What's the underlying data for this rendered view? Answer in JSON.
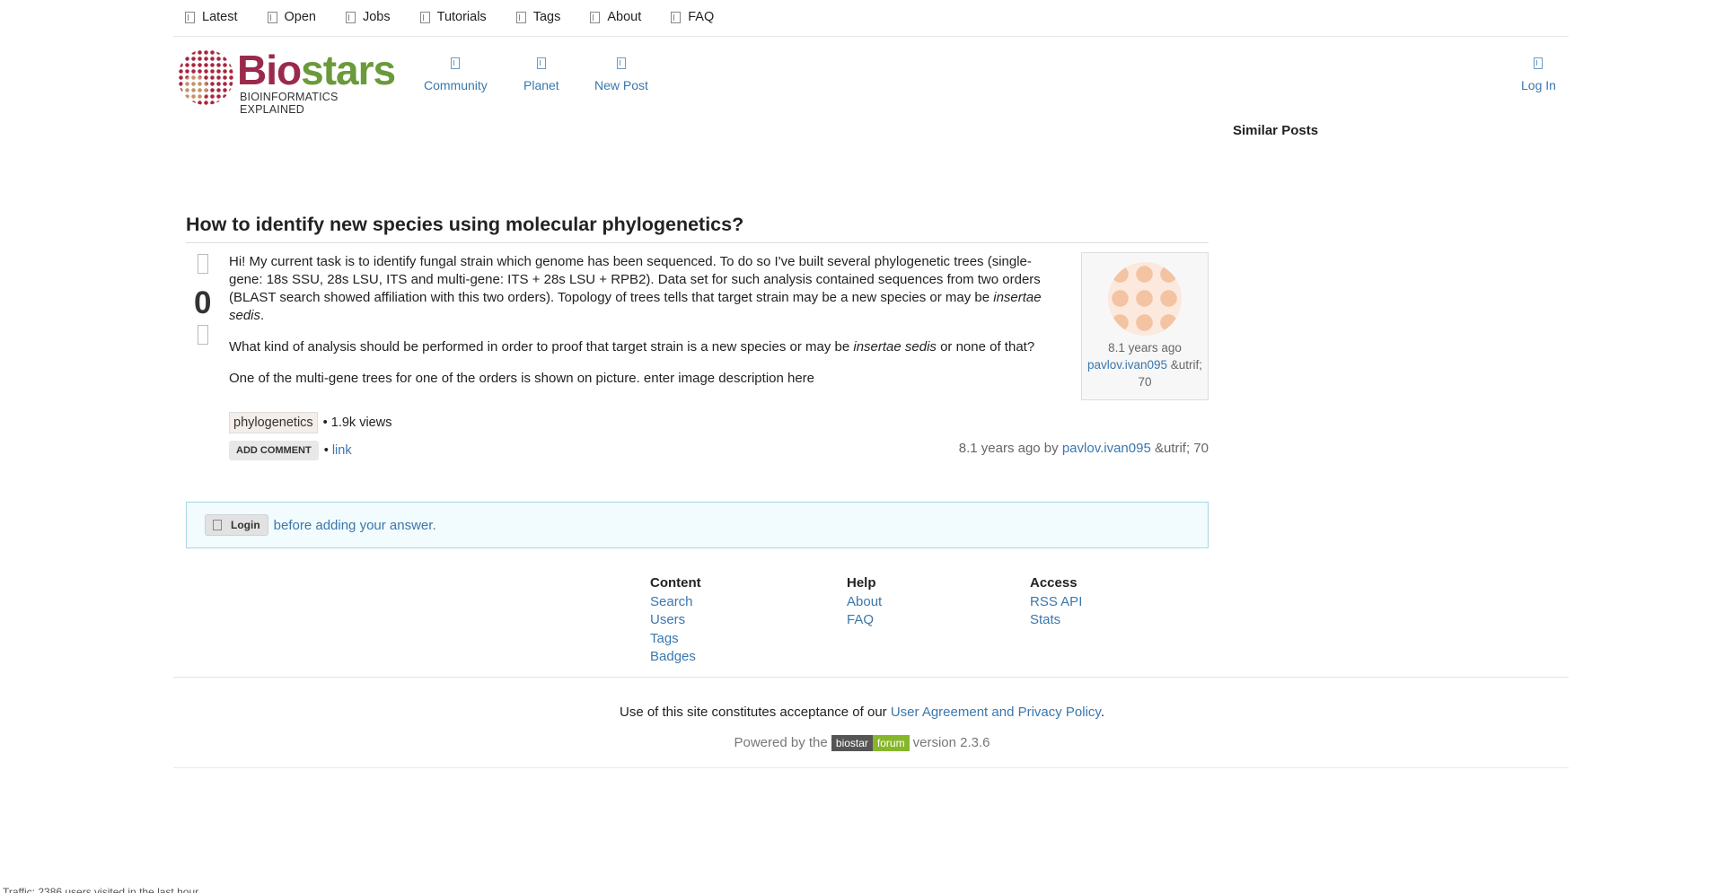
{
  "topnav": [
    {
      "label": "Latest",
      "icon": "list-icon"
    },
    {
      "label": "Open",
      "icon": "list-icon"
    },
    {
      "label": "Jobs",
      "icon": "list-icon"
    },
    {
      "label": "Tutorials",
      "icon": "list-icon"
    },
    {
      "label": "Tags",
      "icon": "list-icon"
    },
    {
      "label": "About",
      "icon": "list-icon"
    },
    {
      "label": "FAQ",
      "icon": "list-icon"
    }
  ],
  "logo": {
    "bio": "Bio",
    "stars": "stars",
    "tagline": "BIOINFORMATICS EXPLAINED",
    "brand_colors": {
      "bio": "#9a2a4b",
      "stars": "#6a9a3a"
    }
  },
  "mainnav": {
    "community": "Community",
    "planet": "Planet",
    "new_post": "New Post",
    "login": "Log In"
  },
  "sidebar": {
    "similar_title": "Similar Posts"
  },
  "post": {
    "title": "How to identify new species using molecular phylogenetics?",
    "vote_count": "0",
    "paragraph1": "Hi! My current task is to identify fungal strain which genome has been sequenced. To do so I've built several phylogenetic trees (single-gene: 18s SSU, 28s LSU, ITS and multi-gene: ITS + 28s LSU + RPB2). Data set for such analysis contained sequences from two orders (BLAST search showed affiliation with this two orders). Topology of trees tells that target strain may be a new species or may be ",
    "paragraph1_em": "insertae sedis",
    "paragraph1_end": ".",
    "paragraph2_start": "What kind of analysis should be performed in order to proof that target strain is a new species or may be ",
    "paragraph2_em": "insertae sedis",
    "paragraph2_end": " or none of that?",
    "paragraph3": "One of the multi-gene trees for one of the orders is shown on picture. enter image description here",
    "tag": "phylogenetics",
    "views": "• 1.9k views",
    "add_comment": "ADD COMMENT",
    "link_sep": "•",
    "link": "link",
    "byline_time": "8.1 years ago by ",
    "byline_user": "pavlov.ivan095",
    "byline_rep": " &utrif; 70"
  },
  "usercard": {
    "time": "8.1 years ago",
    "user": "pavlov.ivan095",
    "rep": "&utrif; 70"
  },
  "answer_box": {
    "login_label": "Login",
    "text": "before adding your answer."
  },
  "footer": {
    "content": {
      "title": "Content",
      "links": [
        "Search",
        "Users",
        "Tags",
        "Badges"
      ]
    },
    "help": {
      "title": "Help",
      "links": [
        "About",
        "FAQ"
      ]
    },
    "access": {
      "title": "Access",
      "links": [
        "RSS API",
        "Stats"
      ]
    },
    "agreement_text": "Use of this site constitutes acceptance of our ",
    "agreement_link": "User Agreement and Privacy Policy",
    "agreement_end": ".",
    "powered_text": "Powered by the ",
    "badge_biostar": "biostar",
    "badge_forum": "forum",
    "version": "version 2.3.6"
  },
  "traffic": "Traffic: 2386 users visited in the last hour"
}
